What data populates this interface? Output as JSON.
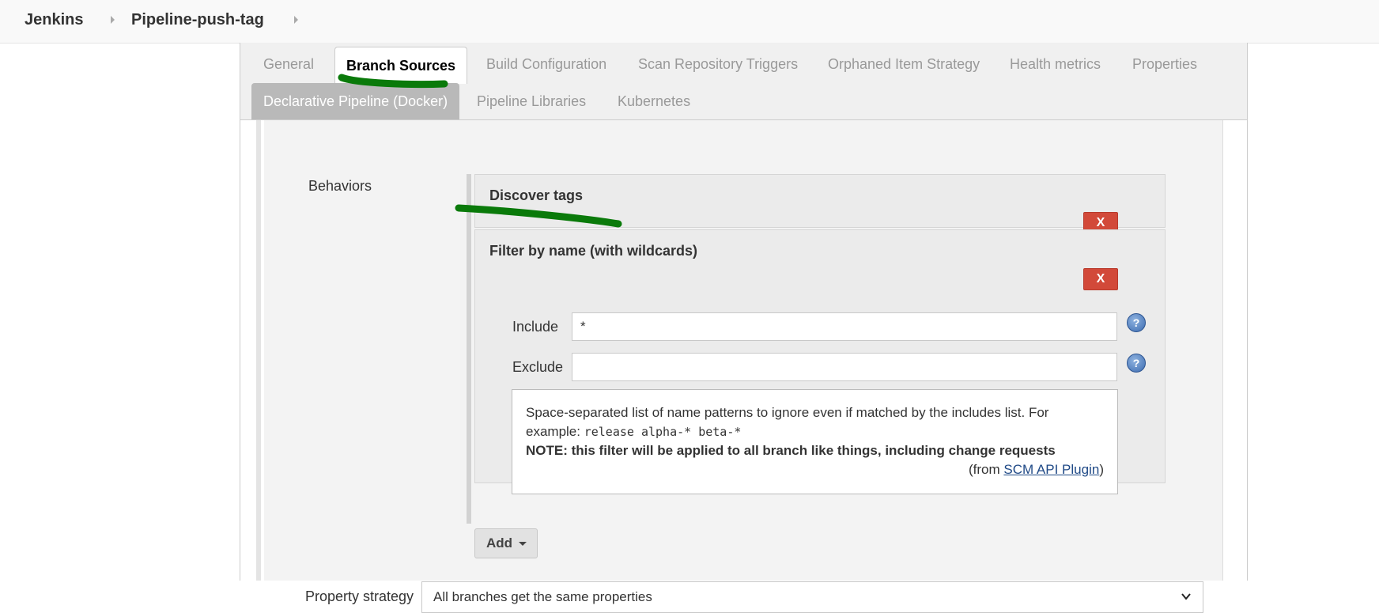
{
  "breadcrumb": {
    "items": [
      "Jenkins",
      "Pipeline-push-tag"
    ]
  },
  "tabs": {
    "row1": [
      "General",
      "Branch Sources",
      "Build Configuration",
      "Scan Repository Triggers",
      "Orphaned Item Strategy",
      "Health metrics",
      "Properties"
    ],
    "row2": [
      "Declarative Pipeline (Docker)",
      "Pipeline Libraries",
      "Kubernetes"
    ],
    "active": "Branch Sources"
  },
  "behaviors": {
    "label": "Behaviors",
    "discover_tags": {
      "title": "Discover tags",
      "delete_label": "X",
      "help_label": "?"
    },
    "filter": {
      "title": "Filter by name (with wildcards)",
      "delete_label": "X",
      "include_label": "Include",
      "include_value": "*",
      "exclude_label": "Exclude",
      "exclude_value": "",
      "help_label": "?",
      "help_text_1": "Space-separated list of name patterns to ignore even if matched by the includes list. For example: ",
      "help_code": "release alpha-* beta-*",
      "help_note": "NOTE: this filter will be applied to all branch like things, including change requests",
      "help_from_prefix": "(from ",
      "help_from_link": "SCM API Plugin",
      "help_from_suffix": ")"
    },
    "add_button": "Add"
  },
  "property_strategy": {
    "label": "Property strategy",
    "selected": "All branches get the same properties"
  },
  "colors": {
    "annotation": "#0a7a0a",
    "delete": "#d24939",
    "link": "#204a87"
  }
}
